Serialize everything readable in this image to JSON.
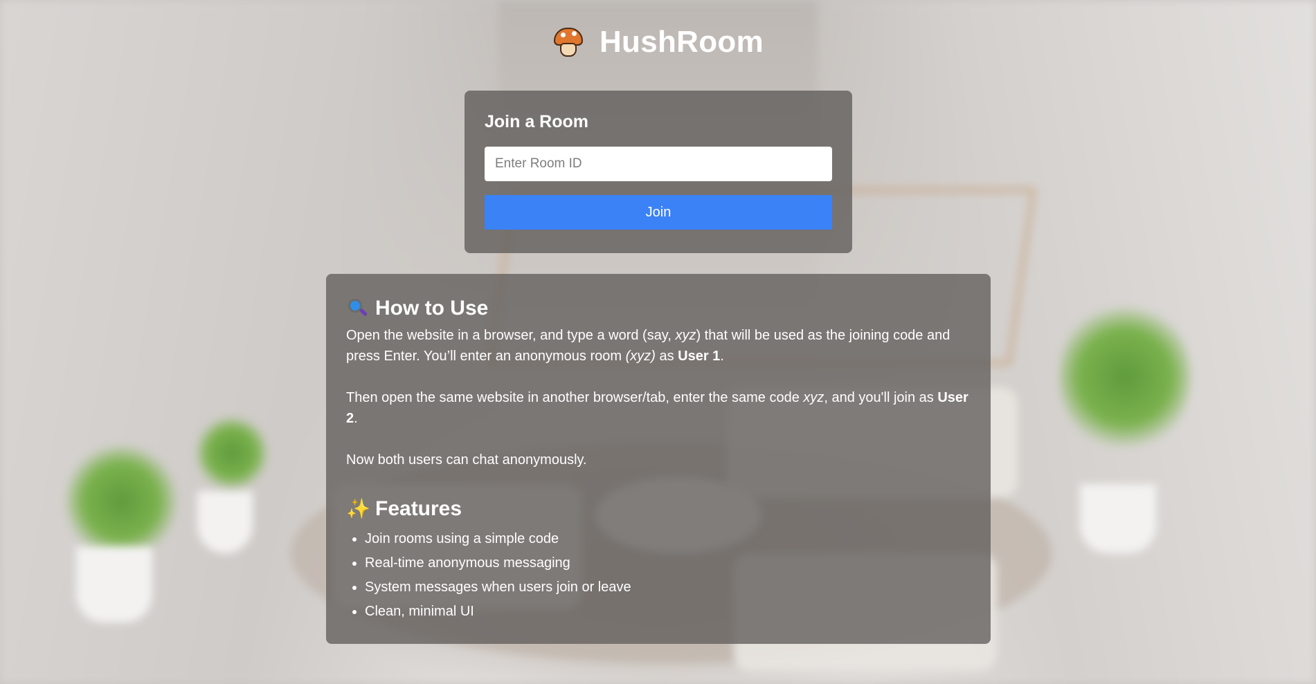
{
  "header": {
    "logo_icon": "mushroom-icon",
    "title": "HushRoom"
  },
  "join": {
    "title": "Join a Room",
    "input_placeholder": "Enter Room ID",
    "input_value": "",
    "button_label": "Join",
    "button_color": "#3b82f6"
  },
  "how_to": {
    "icon": "magnifier-icon",
    "title": "How to Use",
    "p1": {
      "t1": "Open the website in a browser, and type a word (say, ",
      "em1": "xyz",
      "t2": ") that will be used as the joining code and press Enter. You’ll enter an anonymous room ",
      "em2": "(xyz)",
      "t3": " as ",
      "strong": "User 1",
      "t4": "."
    },
    "p2": {
      "t1": "Then open the same website in another browser/tab, enter the same code ",
      "em": "xyz",
      "t2": ", and you'll join as ",
      "strong": "User 2",
      "t3": "."
    },
    "p3": "Now both users can chat anonymously."
  },
  "features": {
    "icon": "sparkles-icon",
    "title": "Features",
    "items": [
      "Join rooms using a simple code",
      "Real-time anonymous messaging",
      "System messages when users join or leave",
      "Clean, minimal UI"
    ]
  }
}
